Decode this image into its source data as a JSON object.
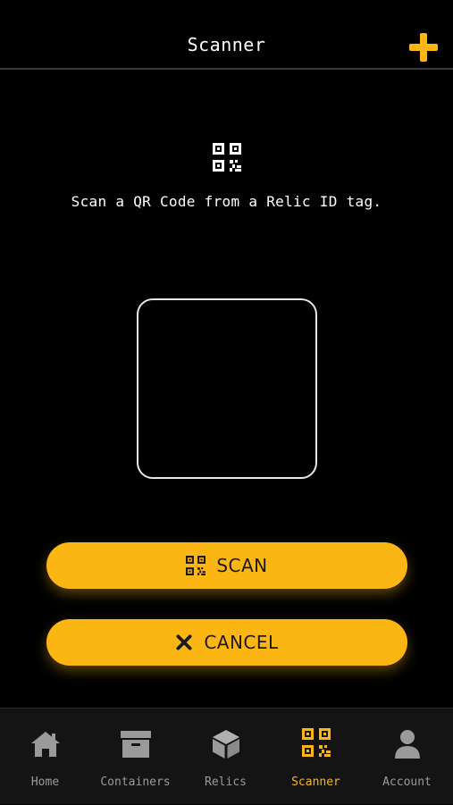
{
  "header": {
    "title": "Scanner",
    "add_icon": "plus-icon"
  },
  "main": {
    "top_icon": "qr-code-icon",
    "instruction": "Scan a QR Code from a Relic ID tag."
  },
  "actions": {
    "scan_label": "SCAN",
    "scan_icon": "qr-code-icon",
    "cancel_label": "CANCEL",
    "cancel_icon": "x-icon"
  },
  "tabbar": {
    "items": [
      {
        "label": "Home",
        "icon": "home-icon",
        "active": false
      },
      {
        "label": "Containers",
        "icon": "archive-box-icon",
        "active": false
      },
      {
        "label": "Relics",
        "icon": "cube-icon",
        "active": false
      },
      {
        "label": "Scanner",
        "icon": "qr-code-icon",
        "active": true
      },
      {
        "label": "Account",
        "icon": "user-icon",
        "active": false
      }
    ]
  },
  "colors": {
    "accent": "#fbb614",
    "background": "#000000",
    "tabbar_bg": "#141414",
    "inactive_tab": "#9a9a9a"
  }
}
